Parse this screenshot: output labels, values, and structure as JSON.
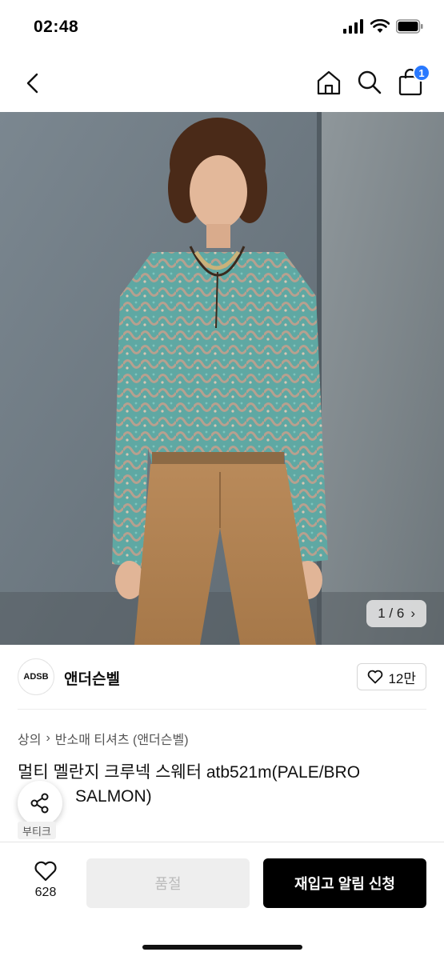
{
  "status_bar": {
    "time": "02:48"
  },
  "nav": {
    "cart_count": "1"
  },
  "gallery": {
    "counter": "1 / 6",
    "next_glyph": "›"
  },
  "brand": {
    "logo_text": "ADSB",
    "name": "앤더슨벨",
    "like_count": "12만"
  },
  "breadcrumb": {
    "level1": "상의",
    "separator": "›",
    "level2": "반소매 티셔츠 (앤더슨벨)"
  },
  "product": {
    "title": "멀티 멜란지 크루넥 스웨터 atb521m(PALE/BRO",
    "title_line2": "SALMON)",
    "tag": "부티크"
  },
  "bottom_bar": {
    "wish_count": "628",
    "soldout_label": "품절",
    "restock_label": "재입고 알림 신청"
  },
  "colors": {
    "badge_blue": "#2979ff",
    "cta_black": "#000000",
    "soldout_bg": "#eeeeee"
  }
}
